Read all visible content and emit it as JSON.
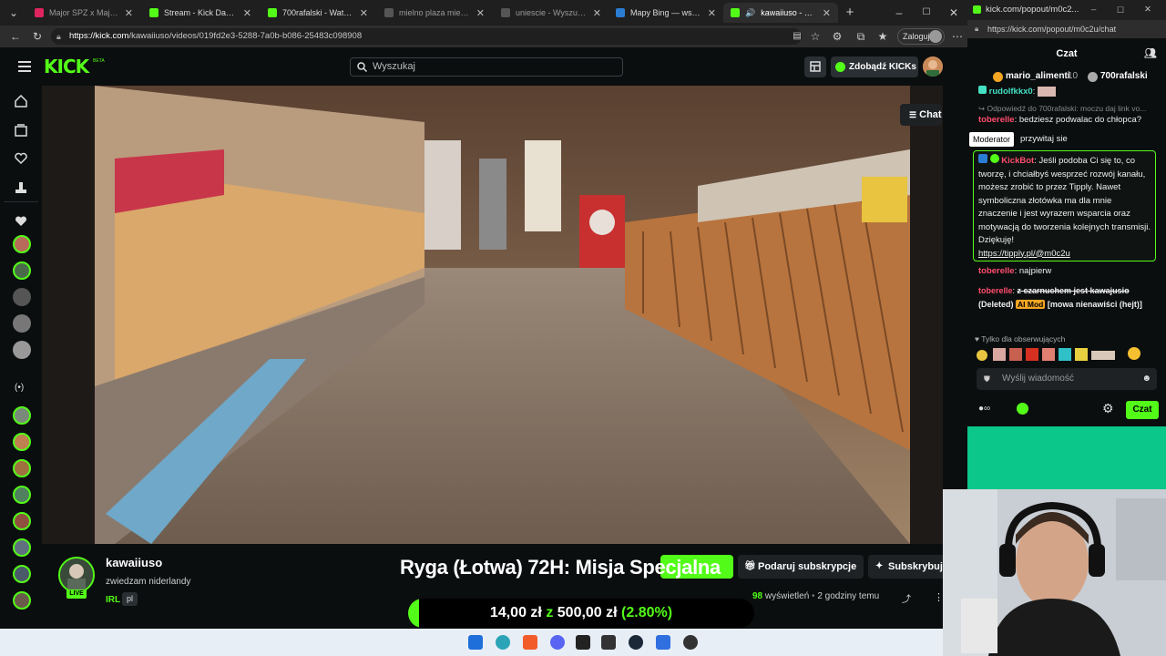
{
  "browser": {
    "tabs": [
      {
        "label": "Major SPZ x Majki - \"Kali",
        "favicon_color": "#e0245e",
        "active": false
      },
      {
        "label": "Stream - Kick Dashboard",
        "favicon_color": "#53fc18",
        "active": false
      },
      {
        "label": "700rafalski - Watch the V",
        "favicon_color": "#53fc18",
        "active": false
      },
      {
        "label": "mielno plaza mieszkania",
        "favicon_color": "#888888",
        "active": false
      },
      {
        "label": "uniescie - Wyszukaj",
        "favicon_color": "#888888",
        "active": false
      },
      {
        "label": "Mapy Bing — wskazówki",
        "favicon_color": "#2b7cd3",
        "active": false
      },
      {
        "label": "kawaiiuso - Watch th",
        "favicon_color": "#53fc18",
        "active": true
      }
    ],
    "url_host": "https://kick.com",
    "url_path": "/kawaiiuso/videos/019fd2e3-5288-7a0b-b086-25483c098908",
    "login_label": "Zaloguj"
  },
  "kick": {
    "logo": "KICK",
    "logo_badge": "BETA",
    "search_placeholder": "Wyszukaj",
    "get_kicks_label": "Zdobądź KICKs",
    "chat_toggle_label": "Chat",
    "channel": {
      "name": "kawaiiuso",
      "title": "zwiedzam niderlandy",
      "category": "IRL",
      "language": "pl",
      "live_badge": "LIVE",
      "views": "98",
      "views_label": "wyświetleń",
      "time_ago": "2 godziny temu"
    },
    "buttons": {
      "gift_sub": "Podaruj subskrypcje",
      "subscribe": "Subskrybuj"
    }
  },
  "overlay": {
    "title": "Ryga (Łotwa) 72H: Misja Specjalna",
    "goal_current": "14,00 zł",
    "goal_separator": "z",
    "goal_target": "500,00 zł",
    "goal_percent_label": "(2.80%)",
    "goal_fraction": 0.028
  },
  "chat_window": {
    "window_title": "kick.com/popout/m0c2...",
    "url": "https://kick.com/popout/m0c2u/chat",
    "header": "Czat",
    "gifters": [
      {
        "name": "mario_alimenti",
        "count": "10"
      },
      {
        "name": "700rafalski",
        "count": ""
      }
    ],
    "reply_note": "Odpowiedź do 700rafalski: moczu daj link vo...",
    "messages": [
      {
        "user": "rudolfkkx0",
        "text": ""
      },
      {
        "user": "toberelle",
        "text": "bedziesz podwalac do chłopca?"
      },
      {
        "user": "",
        "text": "przywitaj sie"
      },
      {
        "user": "toberelle",
        "text": "najpierw"
      },
      {
        "user": "toberelle",
        "text": "z czarnuchem jest kawajusio"
      }
    ],
    "moderator_tooltip": "Moderator",
    "pinned": {
      "user": "KickBot",
      "text": "Jeśli podoba Ci się to, co tworzę, i chciałbyś wesprzeć rozwój kanału, możesz zrobić to przez Tipply. Nawet symboliczna złotówka ma dla mnie znaczenie i jest wyrazem wsparcia oraz motywacją do tworzenia kolejnych transmisji. Dziękuję!",
      "link": "https://tipply.pl/@m0c2u"
    },
    "deleted_label": "(Deleted)",
    "ai_mod_label": "AI Mod",
    "deleted_reason": "[mowa nienawiści (hejt)]",
    "followers_only": "Tylko dla obserwujących",
    "input_placeholder": "Wyślij wiadomość",
    "send_label": "Czat"
  }
}
